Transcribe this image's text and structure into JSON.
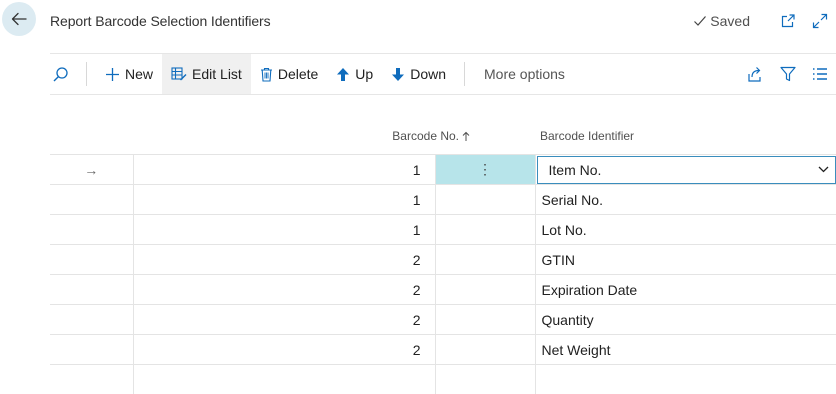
{
  "header": {
    "title": "Report Barcode Selection Identifiers",
    "saved_label": "Saved"
  },
  "actions": {
    "new_label": "New",
    "edit_list_label": "Edit List",
    "delete_label": "Delete",
    "up_label": "Up",
    "down_label": "Down",
    "more_options_label": "More options"
  },
  "grid": {
    "columns": {
      "barcode_no": "Barcode No.",
      "barcode_identifier": "Barcode Identifier"
    },
    "rows": [
      {
        "barcode_no": "1",
        "barcode_identifier": "Item No."
      },
      {
        "barcode_no": "1",
        "barcode_identifier": "Serial No."
      },
      {
        "barcode_no": "1",
        "barcode_identifier": "Lot No."
      },
      {
        "barcode_no": "2",
        "barcode_identifier": "GTIN"
      },
      {
        "barcode_no": "2",
        "barcode_identifier": "Expiration Date"
      },
      {
        "barcode_no": "2",
        "barcode_identifier": "Quantity"
      },
      {
        "barcode_no": "2",
        "barcode_identifier": "Net Weight"
      }
    ],
    "selected_row_arrow": "→",
    "row_menu_glyph": "⋮"
  },
  "colors": {
    "accent": "#0f6cbd",
    "back_button_bg": "#dcebf2",
    "selected_cell": "#b7e4ea",
    "focus_border": "#3a8dbd"
  },
  "icons": [
    "back-arrow-icon",
    "checkmark-icon",
    "open-in-new-icon",
    "expand-icon",
    "search-icon",
    "plus-icon",
    "edit-list-icon",
    "delete-icon",
    "arrow-up-icon",
    "arrow-down-icon",
    "share-icon",
    "filter-icon",
    "list-view-icon",
    "sort-ascending-icon",
    "chevron-down-icon"
  ]
}
